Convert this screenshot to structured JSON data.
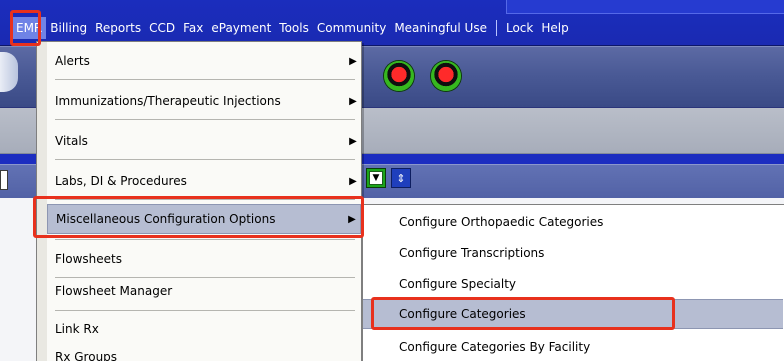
{
  "menubar": {
    "items": [
      {
        "label": "EMR",
        "active": true
      },
      {
        "label": "Billing"
      },
      {
        "label": "Reports"
      },
      {
        "label": "CCD"
      },
      {
        "label": "Fax"
      },
      {
        "label": "ePayment"
      },
      {
        "label": "Tools"
      },
      {
        "label": "Community"
      },
      {
        "label": "Meaningful Use"
      },
      {
        "label": "Lock"
      },
      {
        "label": "Help"
      }
    ]
  },
  "emr_menu": {
    "items": [
      {
        "label": "Alerts",
        "has_submenu": true
      },
      {
        "label": "Immunizations/Therapeutic Injections",
        "has_submenu": true
      },
      {
        "label": "Vitals",
        "has_submenu": true
      },
      {
        "label": "Labs, DI & Procedures",
        "has_submenu": true
      },
      {
        "label": "Miscellaneous Configuration Options",
        "has_submenu": true,
        "highlighted": true
      },
      {
        "label": "Flowsheets"
      },
      {
        "label": "Flowsheet Manager"
      },
      {
        "label": "Link Rx"
      },
      {
        "label": "Rx Groups"
      }
    ]
  },
  "misc_submenu": {
    "items": [
      {
        "label": "Configure Orthopaedic Categories"
      },
      {
        "label": "Configure Transcriptions"
      },
      {
        "label": "Configure Specialty"
      },
      {
        "label": "Configure Categories",
        "highlighted": true
      },
      {
        "label": "Configure Categories By Facility"
      }
    ]
  },
  "colors": {
    "menubar_bg": "#1b2dbd",
    "menu_highlight": "#b6bdd2",
    "annotation_red": "#e8311d",
    "status_light_red": "#ff2a2a",
    "status_light_green": "#36b81e"
  },
  "icons": {
    "submenu_arrow": "chevron-right-icon",
    "status_light": "status-light-icon",
    "dropdown_toggle": "dropdown-arrow-icon",
    "spin_button": "spin-icon"
  }
}
